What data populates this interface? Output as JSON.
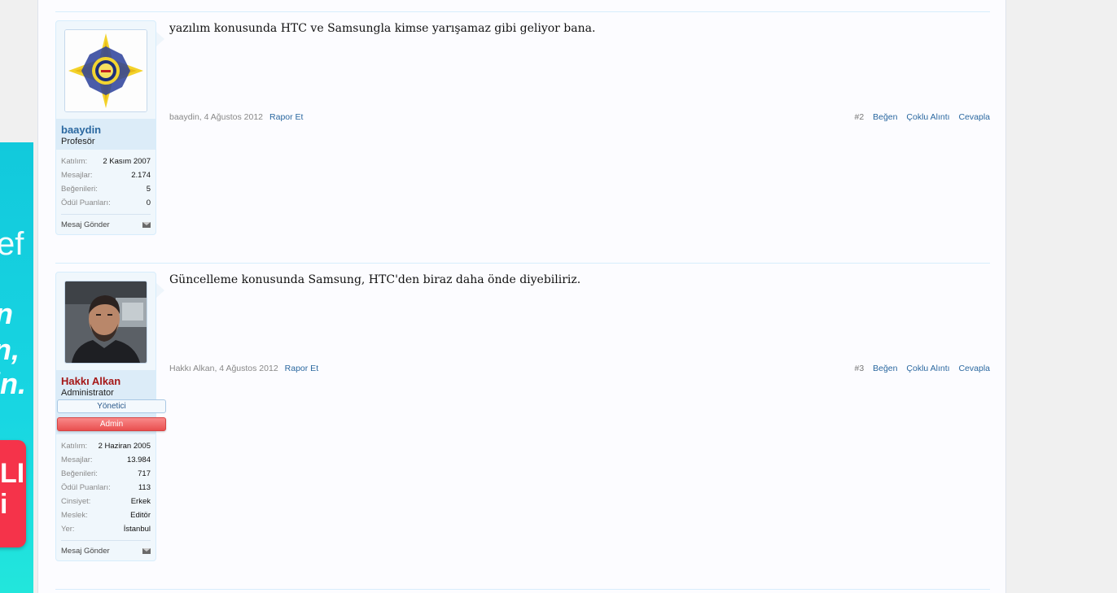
{
  "ad": {
    "line1": "ef",
    "line2": "n",
    "line3": "n,",
    "line4": "in.",
    "button_line1": "LI",
    "button_line2": "i"
  },
  "posts": [
    {
      "user": {
        "name": "baaydin",
        "title": "Profesör",
        "stats": [
          {
            "label": "Katılım:",
            "value": "2 Kasım 2007"
          },
          {
            "label": "Mesajlar:",
            "value": "2.174"
          },
          {
            "label": "Beğenileri:",
            "value": "5"
          },
          {
            "label": "Ödül Puanları:",
            "value": "0"
          }
        ],
        "send_message": "Mesaj Gönder"
      },
      "message": "yazılım konusunda HTC ve Samsungla kimse yarışamaz gibi geliyor bana.",
      "meta": {
        "author_date": "baaydin, 4 Ağustos 2012",
        "report": "Rapor Et",
        "post_number": "#2",
        "like": "Beğen",
        "multi_quote": "Çoklu Alıntı",
        "reply": "Cevapla"
      }
    },
    {
      "user": {
        "name": "Hakkı Alkan",
        "title": "Administrator",
        "banner_mod": "Yönetici",
        "banner_admin": "Admin",
        "stats": [
          {
            "label": "Katılım:",
            "value": "2 Haziran 2005"
          },
          {
            "label": "Mesajlar:",
            "value": "13.984"
          },
          {
            "label": "Beğenileri:",
            "value": "717"
          },
          {
            "label": "Ödül Puanları:",
            "value": "113"
          },
          {
            "label": "Cinsiyet:",
            "value": "Erkek"
          },
          {
            "label": "Meslek:",
            "value": "Editör"
          },
          {
            "label": "Yer:",
            "value": "İstanbul"
          }
        ],
        "send_message": "Mesaj Gönder"
      },
      "message": "Güncelleme konusunda Samsung, HTC'den biraz daha önde diyebiliriz.",
      "meta": {
        "author_date": "Hakkı Alkan, 4 Ağustos 2012",
        "report": "Rapor Et",
        "post_number": "#3",
        "like": "Beğen",
        "multi_quote": "Çoklu Alıntı",
        "reply": "Cevapla"
      }
    }
  ]
}
